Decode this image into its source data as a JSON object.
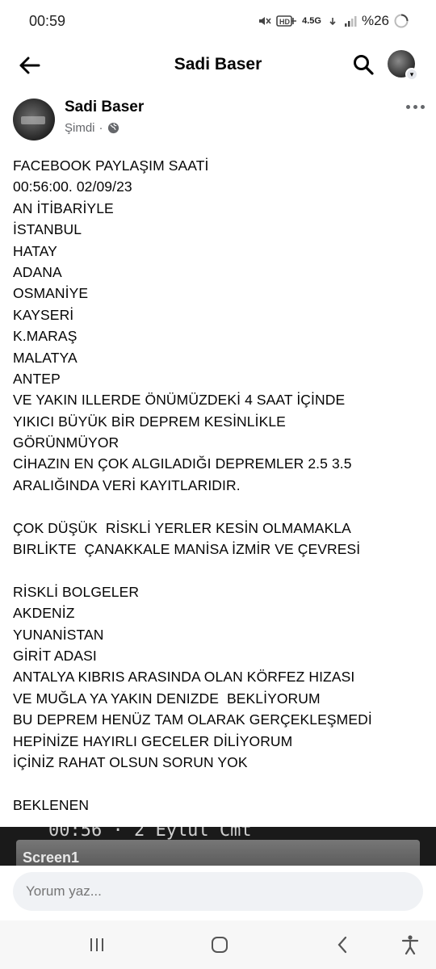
{
  "status_bar": {
    "time": "00:59",
    "network_type": "4.5G",
    "battery": "%26"
  },
  "header": {
    "title": "Sadi Baser"
  },
  "post": {
    "author": "Sadi Baser",
    "timestamp": "Şimdi",
    "separator": "·",
    "lines": [
      "FACEBOOK PAYLAŞIM SAATİ",
      "00:56:00. 02/09/23",
      "AN İTİBARİYLE",
      "İSTANBUL",
      "HATAY",
      "ADANA",
      "OSMANİYE",
      "KAYSERİ",
      "K.MARAŞ",
      "MALATYA",
      "ANTEP",
      "VE YAKIN ILLERDE ÖNÜMÜZDEKİ 4 SAAT İÇİNDE",
      "YIKICI BÜYÜK BİR DEPREM KESİNLİKLE",
      "GÖRÜNMÜYOR",
      "CİHAZIN EN ÇOK ALGILADIĞI DEPREMLER 2.5 3.5",
      "ARALIĞINDA VERİ KAYITLARIDIR.",
      "",
      "ÇOK DÜŞÜK  RİSKLİ YERLER KESİN OLMAMAKLA",
      "BIRLİKTE  ÇANAKKALE MANİSA İZMİR VE ÇEVRESİ",
      "",
      "RİSKLİ BOLGELER",
      "AKDENİZ",
      "YUNANİSTAN",
      "GİRİT ADASI",
      "ANTALYA KIBRIS ARASINDA OLAN KÖRFEZ HIZASI",
      "VE MUĞLA YA YAKIN DENIZDE  BEKLİYORUM",
      "BU DEPREM HENÜZ TAM OLARAK GERÇEKLEŞMEDİ",
      "HEPİNİZE HAYIRLI GECELER DİLİYORUM",
      "İÇİNİZ RAHAT OLSUN SORUN YOK",
      "",
      "BEKLENEN"
    ],
    "image_text_top": "00:56 · 2 Eylül Cmt",
    "image_text": "Screen1"
  },
  "comment": {
    "placeholder": "Yorum yaz..."
  },
  "icons": {
    "back": "arrow-left-icon",
    "search": "search-icon",
    "more": "more-horizontal-icon",
    "audience": "globe-icon",
    "nav_recents": "recents-icon",
    "nav_home": "home-icon",
    "nav_back": "back-icon",
    "nav_accessibility": "accessibility-icon"
  }
}
